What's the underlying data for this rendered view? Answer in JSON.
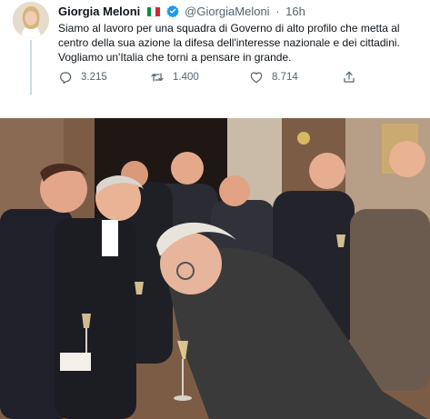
{
  "tweet": {
    "author_name": "Giorgia Meloni",
    "handle": "@GiorgiaMeloni",
    "separator": "·",
    "time": "16h",
    "text_lines": [
      "Siamo al lavoro per una squadra di Governo di alto profilo che metta al",
      "centro della sua azione la difesa dell'interesse nazionale e dei cittadini.",
      "Vogliamo un'Italia che torni a pensare in grande."
    ],
    "icons": {
      "flag": "italian-flag-icon",
      "verified": "verified-badge-icon",
      "reply": "reply-icon",
      "retweet": "retweet-icon",
      "like": "like-icon",
      "share": "share-icon"
    },
    "actions": {
      "replies": "3.215",
      "retweets": "1.400",
      "likes": "8.714"
    },
    "colors": {
      "verified": "#1d9bf0",
      "muted": "#536471",
      "flag_green": "#009246",
      "flag_white": "#ffffff",
      "flag_red": "#ce2b37"
    }
  },
  "media": {
    "kind": "photo"
  }
}
